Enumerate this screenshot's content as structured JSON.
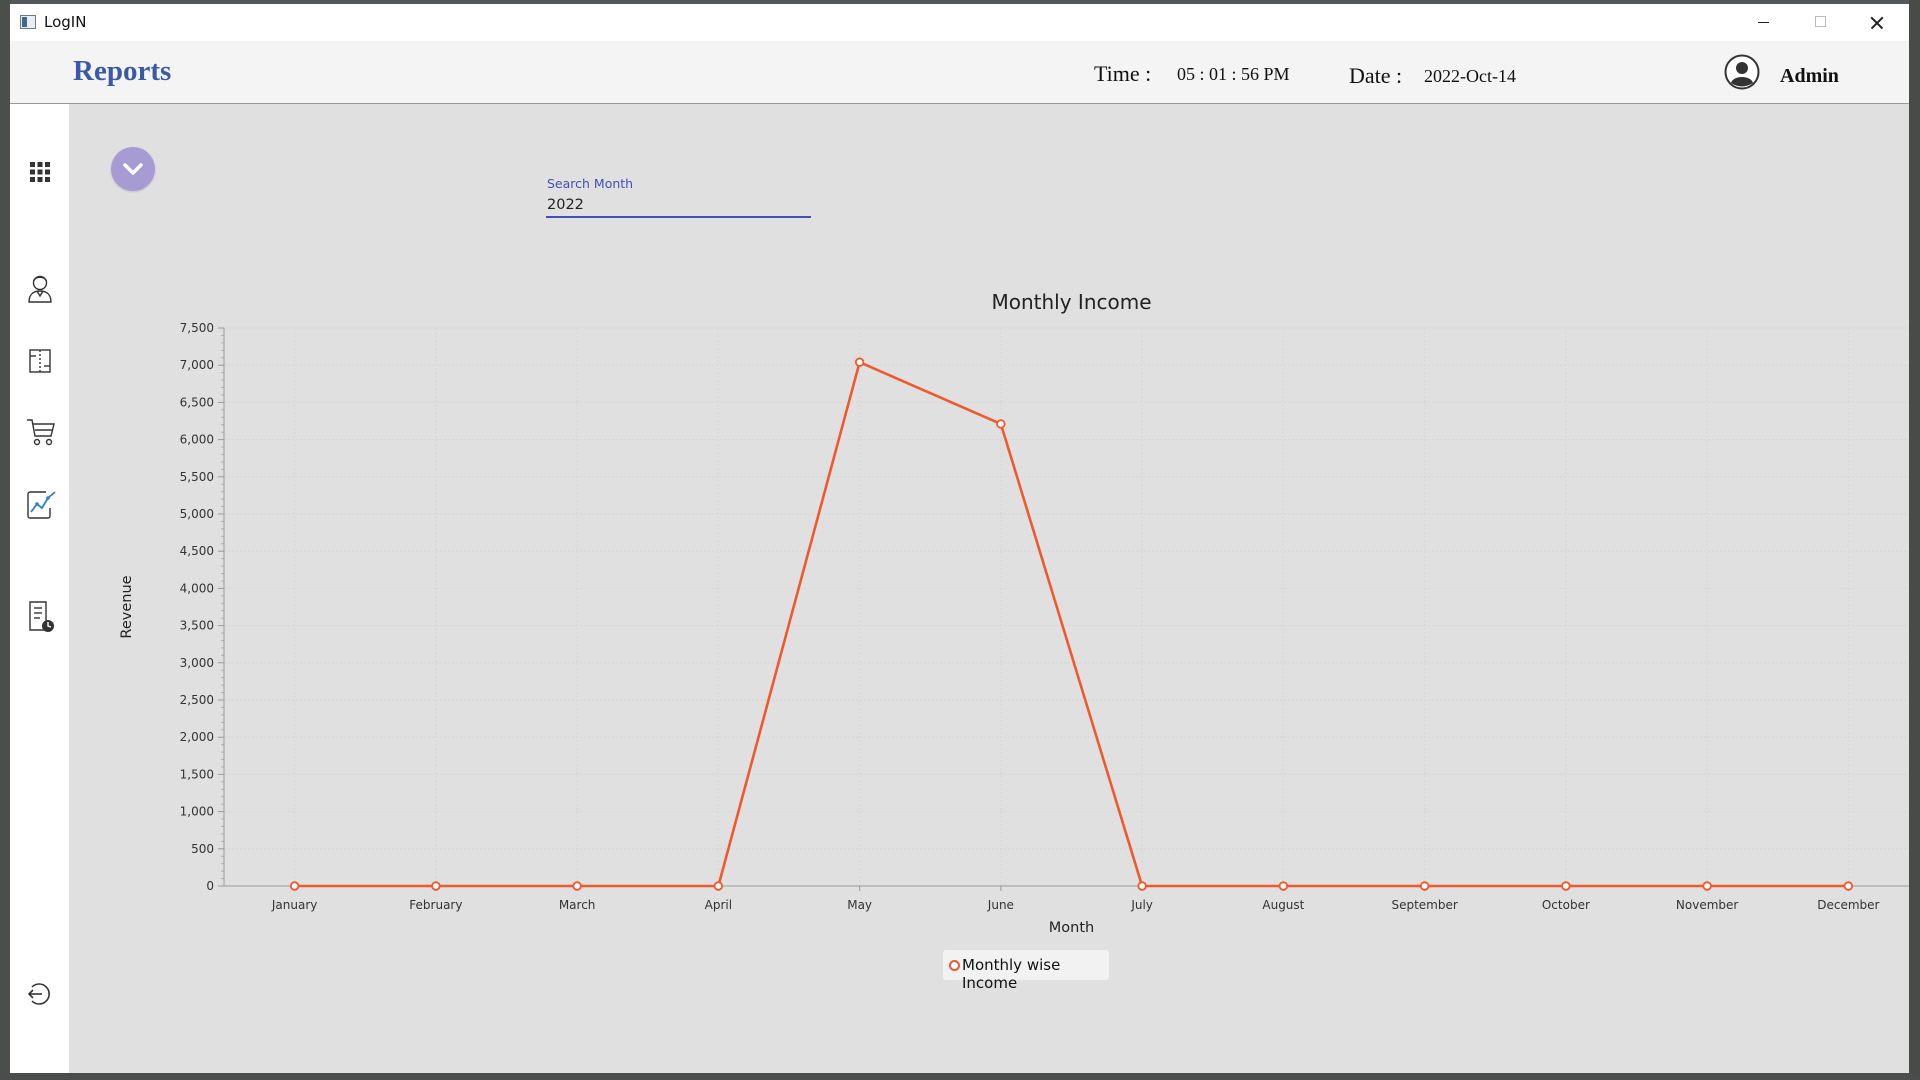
{
  "window": {
    "title": "LogIN"
  },
  "header": {
    "title": "Reports",
    "time_label": "Time :",
    "time_value": "05 : 01 : 56 PM",
    "date_label": "Date :",
    "date_value": "2022-Oct-14",
    "user": "Admin"
  },
  "sidebar": {
    "items": [
      {
        "icon": "apps-grid-icon"
      },
      {
        "icon": "user-icon"
      },
      {
        "icon": "table-icon"
      },
      {
        "icon": "cart-icon"
      },
      {
        "icon": "trend-chart-icon",
        "active": true
      },
      {
        "icon": "bill-report-icon"
      },
      {
        "icon": "logout-icon"
      }
    ]
  },
  "search": {
    "label": "Search Month",
    "value": "2022"
  },
  "colors": {
    "accent": "#3f51b5",
    "series": "#f0582d",
    "toggle": "#a79bd4",
    "brand": "#3b5aa6"
  },
  "chart_data": {
    "type": "line",
    "title": "Monthly Income",
    "xlabel": "Month",
    "ylabel": "Revenue",
    "categories": [
      "January",
      "February",
      "March",
      "April",
      "May",
      "June",
      "July",
      "August",
      "September",
      "October",
      "November",
      "December"
    ],
    "series": [
      {
        "name": "Monthly wise Income",
        "values": [
          0,
          0,
          0,
          0,
          7040,
          6210,
          0,
          0,
          0,
          0,
          0,
          0
        ]
      }
    ],
    "ylim": [
      0,
      7500
    ],
    "yticks": [
      "0",
      "500",
      "1,000",
      "1,500",
      "2,000",
      "2,500",
      "3,000",
      "3,500",
      "4,000",
      "4,500",
      "5,000",
      "5,500",
      "6,000",
      "6,500",
      "7,000",
      "7,500"
    ],
    "grid": true,
    "legend": "bottom-center"
  }
}
